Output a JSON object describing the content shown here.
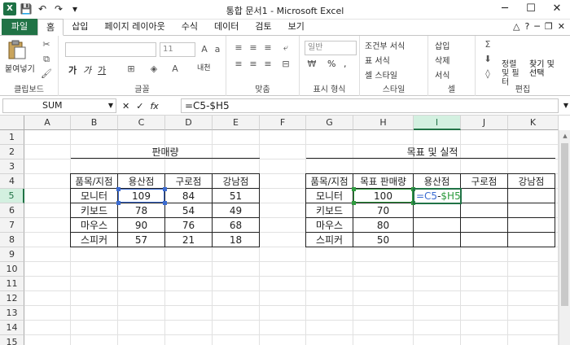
{
  "window": {
    "title": "통합 문서1  -  Microsoft Excel",
    "minimize": "─",
    "maximize": "☐",
    "close": "✕"
  },
  "qat": {
    "save": "💾",
    "undo": "↶",
    "redo": "↷",
    "customize": "▾"
  },
  "tabs": [
    {
      "label": "파일"
    },
    {
      "label": "홈"
    },
    {
      "label": "삽입"
    },
    {
      "label": "페이지 레이아웃"
    },
    {
      "label": "수식"
    },
    {
      "label": "데이터"
    },
    {
      "label": "검토"
    },
    {
      "label": "보기"
    }
  ],
  "ribbon": {
    "clipboard": {
      "label": "클립보드",
      "paste": "붙여넣기"
    },
    "font": {
      "label": "글꼴",
      "size": "11",
      "bold": "가",
      "italic": "가",
      "underline": "가",
      "phonetic": "내천"
    },
    "alignment": {
      "label": "맞춤"
    },
    "number": {
      "label": "표시 형식",
      "format": "일반",
      "percent": "%",
      "comma": ","
    },
    "styles": {
      "label": "스타일",
      "conditional": "조건부 서식",
      "table": "표 서식",
      "cell_style": "셀 스타일"
    },
    "cells": {
      "label": "셀",
      "insert": "삽입",
      "delete": "삭제",
      "format": "서식"
    },
    "editing": {
      "label": "편집",
      "sort": "정렬 및 필터",
      "find": "찾기 및 선택"
    }
  },
  "formula_bar": {
    "name_box": "SUM",
    "cancel": "✕",
    "enter": "✓",
    "fx": "fx",
    "formula": "=C5-$H5"
  },
  "columns": [
    "A",
    "B",
    "C",
    "D",
    "E",
    "F",
    "G",
    "H",
    "I",
    "J",
    "K"
  ],
  "rows": [
    "1",
    "2",
    "3",
    "4",
    "5",
    "6",
    "7",
    "8",
    "9",
    "10",
    "11",
    "12",
    "13",
    "14",
    "15"
  ],
  "sales_table": {
    "title": "판매량",
    "headers": [
      "품목/지점",
      "용산점",
      "구로점",
      "강남점"
    ],
    "rows": [
      [
        "모니터",
        "109",
        "84",
        "51"
      ],
      [
        "키보드",
        "78",
        "54",
        "49"
      ],
      [
        "마우스",
        "90",
        "76",
        "68"
      ],
      [
        "스피커",
        "57",
        "21",
        "18"
      ]
    ]
  },
  "target_table": {
    "title": "목표 및 실적",
    "headers": [
      "품목/지점",
      "목표 판매량",
      "용산점",
      "구로점",
      "강남점"
    ],
    "rows": [
      [
        "모니터",
        "100",
        "",
        "",
        ""
      ],
      [
        "키보드",
        "70",
        "",
        "",
        ""
      ],
      [
        "마우스",
        "80",
        "",
        "",
        ""
      ],
      [
        "스피커",
        "50",
        "",
        "",
        ""
      ]
    ],
    "editing_cell": {
      "part1": "=C5",
      "part2": "-",
      "part3": "$H5"
    }
  },
  "colors": {
    "excel_green": "#217346",
    "ref_blue": "#3b6bd1",
    "ref_green": "#2e9b3e"
  }
}
